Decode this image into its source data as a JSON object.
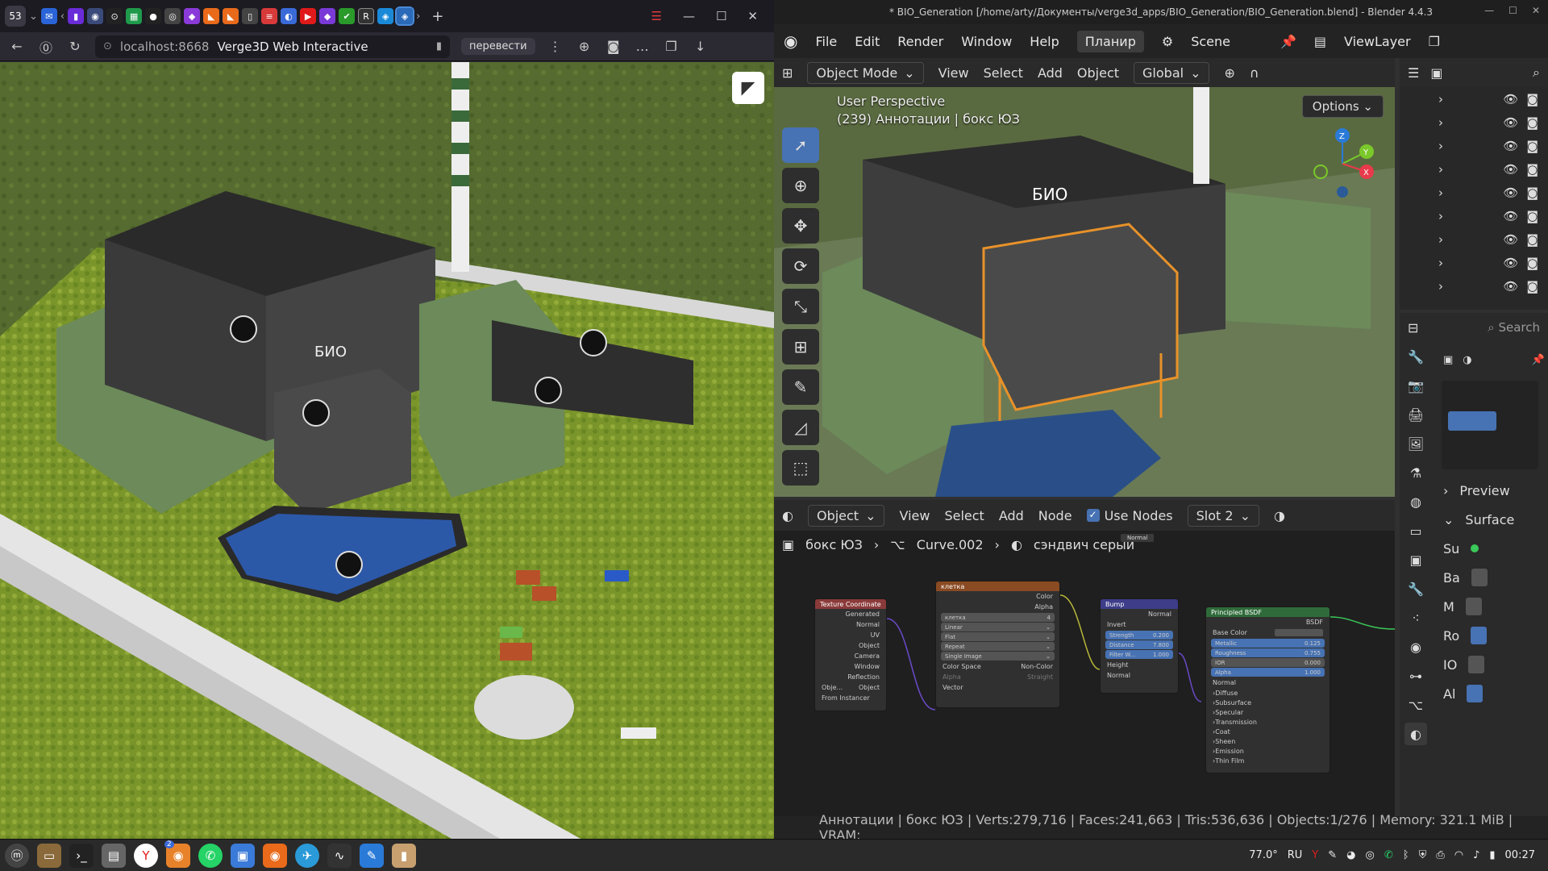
{
  "browser": {
    "tab_count": "53",
    "url": "localhost:8668",
    "page_title": "Verge3D Web Interactive",
    "translate_label": "перевести"
  },
  "blender": {
    "window_title": "* BIO_Generation [/home/arty/Документы/verge3d_apps/BIO_Generation/BIO_Generation.blend] - Blender 4.4.3",
    "menu": [
      "File",
      "Edit",
      "Render",
      "Window",
      "Help"
    ],
    "workspace": "Планир",
    "scene": "Scene",
    "view_layer": "ViewLayer",
    "viewport": {
      "mode": "Object Mode",
      "menu": [
        "View",
        "Select",
        "Add",
        "Object"
      ],
      "orientation": "Global",
      "options": "Options",
      "perspective": "User Perspective",
      "collection": "(239) Аннотации | бокс ЮЗ",
      "gizmo": {
        "z": "Z",
        "y": "Y",
        "x": "X"
      }
    },
    "node_editor": {
      "type": "Object",
      "menu": [
        "View",
        "Select",
        "Add",
        "Node"
      ],
      "use_nodes": "Use Nodes",
      "slot": "Slot 2",
      "breadcrumb": {
        "object": "бокс ЮЗ",
        "data": "Curve.002",
        "material": "сэндвич серый"
      },
      "floating_label": "Normal",
      "nodes": {
        "tex_coord": {
          "title": "Texture Coordinate",
          "outputs": [
            "Generated",
            "Normal",
            "UV",
            "Object",
            "Camera",
            "Window",
            "Reflection"
          ],
          "obj_label": "Obje...",
          "obj_value": "Object",
          "from_instancer": "From Instancer"
        },
        "image": {
          "title": "клетка",
          "outputs": [
            "Color",
            "Alpha"
          ],
          "image_name": "клетка",
          "image_users": "4",
          "interpolation": "Linear",
          "projection": "Flat",
          "extension": "Repeat",
          "source": "Single Image",
          "color_space_label": "Color Space",
          "color_space": "Non-Color",
          "alpha_label": "Alpha",
          "alpha_value": "Straight",
          "vector": "Vector"
        },
        "bump": {
          "title": "Bump",
          "output": "Normal",
          "invert": "Invert",
          "strength_label": "Strength",
          "strength": "0.200",
          "distance_label": "Distance",
          "distance": "7.800",
          "filter_label": "Filter W...",
          "filter": "1.000",
          "height": "Height",
          "normal": "Normal"
        },
        "bsdf": {
          "title": "Principled BSDF",
          "output": "BSDF",
          "base_color": "Base Color",
          "metallic_label": "Metallic",
          "metallic": "0.125",
          "roughness_label": "Roughness",
          "roughness": "0.755",
          "ior_label": "IOR",
          "ior": "0.000",
          "alpha_label": "Alpha",
          "alpha": "1.000",
          "normal": "Normal",
          "panels": [
            "Diffuse",
            "Subsurface",
            "Specular",
            "Transmission",
            "Coat",
            "Sheen",
            "Emission",
            "Thin Film"
          ]
        }
      }
    },
    "outliner_rows": 9,
    "properties": {
      "search": "Search",
      "preview": "Preview",
      "surface": "Surface",
      "surface_short": "Su",
      "fields": [
        "Ba",
        "M",
        "Ro",
        "IO",
        "Al"
      ]
    },
    "status_bar": "Аннотации | бокс ЮЗ | Verts:279,716 | Faces:241,663 | Tris:536,636 | Objects:1/276 | Memory: 321.1 MiB | VRAM:"
  },
  "taskbar": {
    "temp": "77.0°",
    "lang": "RU",
    "time": "00:27",
    "yandex_badge": "2"
  },
  "colors": {
    "accent": "#4772b3",
    "orange_select": "#e8922a",
    "bsdf_header": "#2f6b3a",
    "tex_header": "#8b3a3a",
    "image_header": "#8a4a22",
    "bump_header": "#3d3d8a"
  }
}
